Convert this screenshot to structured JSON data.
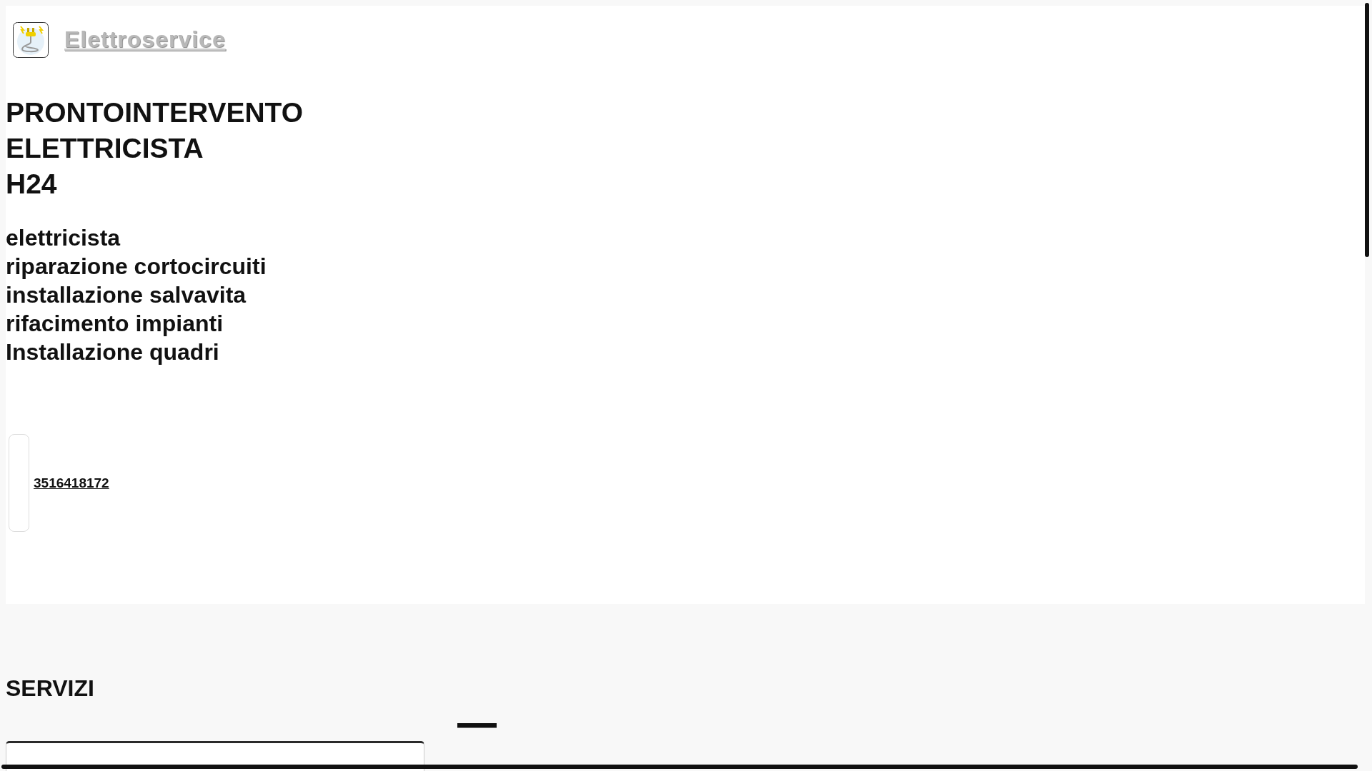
{
  "header": {
    "site_name": "Elettroservice"
  },
  "hero": {
    "title_lines": [
      "PRONTOINTERVENTO",
      "ELETTRICISTA",
      "H24"
    ],
    "services": [
      "elettricista",
      "riparazione cortocircuiti",
      "installazione salvavita",
      "rifacimento impianti",
      "Installazione quadri"
    ],
    "phone": "3516418172"
  },
  "section": {
    "title": "SERVIZI"
  }
}
